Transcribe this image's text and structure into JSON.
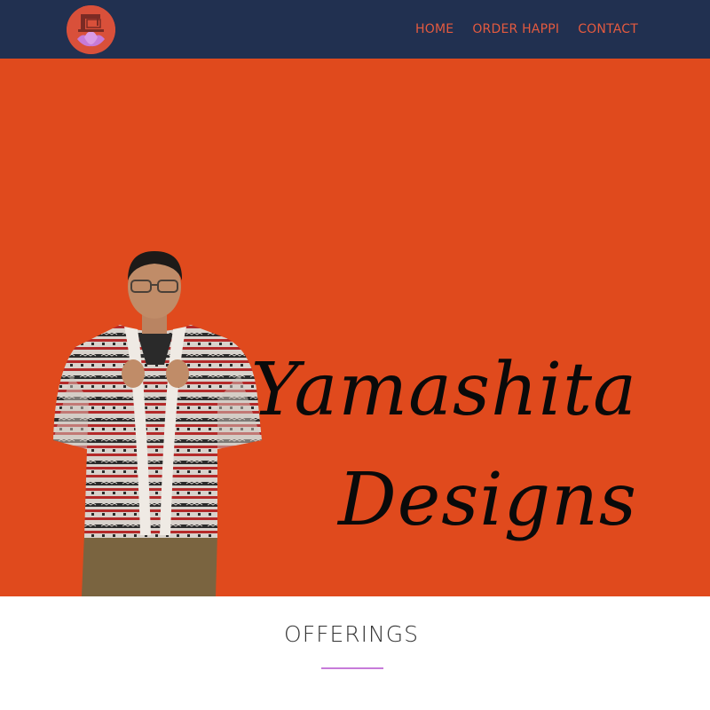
{
  "logo": {
    "icon": "sewing-machine-lotus-icon"
  },
  "nav": {
    "items": [
      {
        "label": "HOME"
      },
      {
        "label": "ORDER HAPPI"
      },
      {
        "label": "CONTACT"
      }
    ]
  },
  "hero": {
    "title_line1": "Yamashita",
    "title_line2": "Designs",
    "image": "man-wearing-patterned-happi-jacket"
  },
  "offerings": {
    "title": "OFFERINGS"
  },
  "colors": {
    "nav_bg": "#213050",
    "nav_link": "#e45a3f",
    "hero_bg": "#e04a1d",
    "accent_underline": "#c77bd9"
  }
}
